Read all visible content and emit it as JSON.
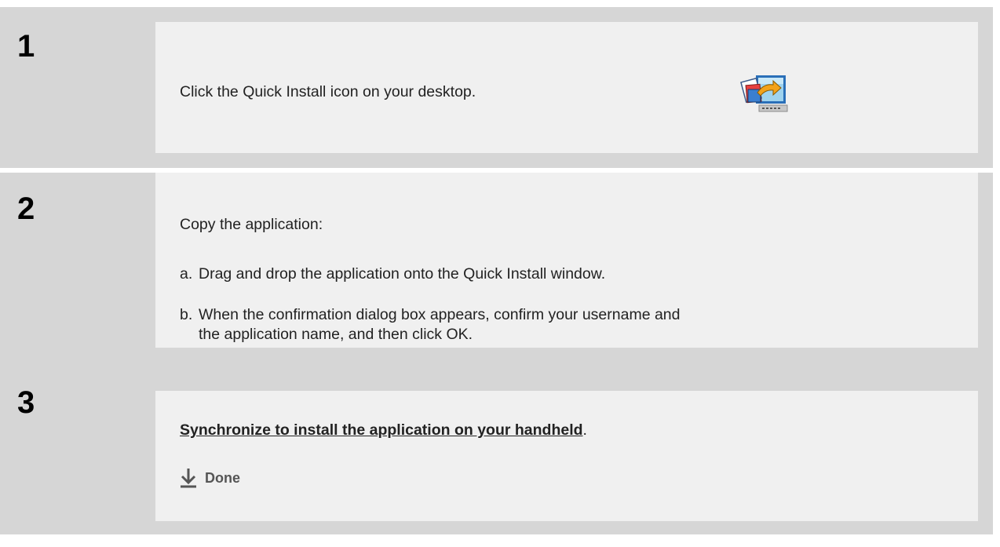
{
  "steps": [
    {
      "number": "1",
      "text": "Click the Quick Install icon on your desktop.",
      "icon": "quick-install-icon"
    },
    {
      "number": "2",
      "intro": "Copy the application:",
      "substeps": [
        {
          "letter": "a.",
          "lines": [
            "Drag and drop the application onto the Quick Install window."
          ]
        },
        {
          "letter": "b.",
          "lines": [
            "When the confirmation dialog box appears, confirm your username and",
            "the application name, and then click OK."
          ]
        }
      ]
    },
    {
      "number": "3",
      "link_text": "Synchronize to install the application on your handheld",
      "link_suffix": ".",
      "done_label": "Done",
      "done_icon": "down-arrow-icon"
    }
  ],
  "colors": {
    "outer": "#d6d6d6",
    "panel": "#f0f0f0",
    "text": "#222222",
    "done": "#555555"
  }
}
